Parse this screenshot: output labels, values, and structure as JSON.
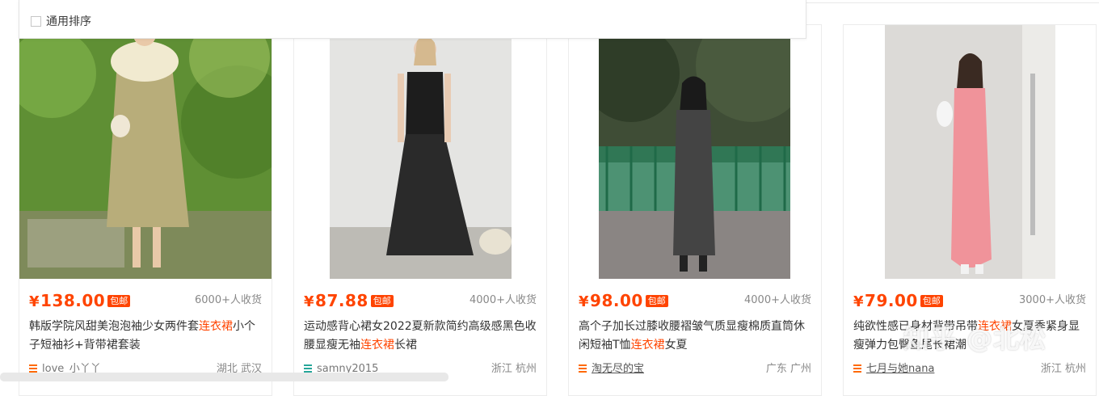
{
  "sort_menu": {
    "option_label": "通用排序"
  },
  "products": [
    {
      "price": "138.00",
      "currency": "¥",
      "free_shipping": "包邮",
      "deals": "6000+人收货",
      "title_before": "韩版学院风甜美泡泡袖少女两件套",
      "title_highlight": "连衣裙",
      "title_after": "小个子短袖衫+背带裙套装",
      "shop": "love_小丫丫",
      "location": "湖北 武汉"
    },
    {
      "price": "87.88",
      "currency": "¥",
      "free_shipping": "包邮",
      "deals": "4000+人收货",
      "title_before": "运动感背心裙女2022夏新款简约高级感黑色收腰显瘦无袖",
      "title_highlight": "连衣裙",
      "title_after": "长裙",
      "shop": "samny2015",
      "location": "浙江 杭州"
    },
    {
      "price": "98.00",
      "currency": "¥",
      "free_shipping": "包邮",
      "deals": "4000+人收货",
      "title_before": "高个子加长过膝收腰褶皱气质显瘦棉质直筒休闲短袖T恤",
      "title_highlight": "连衣裙",
      "title_after": "女夏",
      "shop": "淘无尽的宝",
      "location": "广东 广州"
    },
    {
      "price": "79.00",
      "currency": "¥",
      "free_shipping": "包邮",
      "deals": "3000+人收货",
      "title_before": "纯欲性感已身材背带吊带",
      "title_highlight": "连衣裙",
      "title_after": "女夏季紧身显瘦弹力包臀鱼尾长裙潮",
      "shop": "七月与她nana",
      "location": "浙江 杭州"
    }
  ],
  "watermark": "知乎 @北松"
}
